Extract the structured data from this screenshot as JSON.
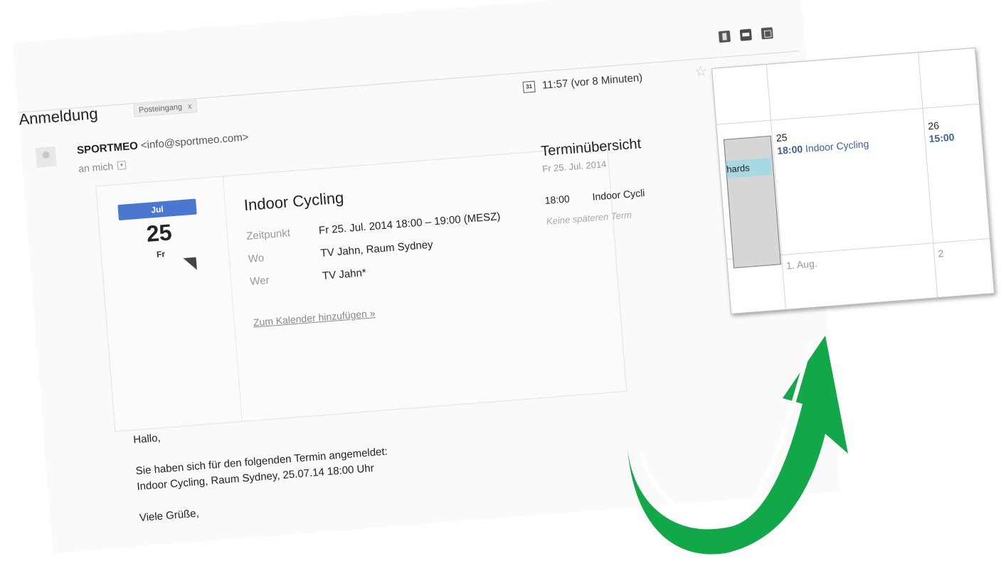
{
  "email": {
    "subject": "Anmeldung",
    "label": "Posteingang",
    "label_close": "x",
    "time": "11:57 (vor 8 Minuten)",
    "calendar_icon_text": "31",
    "sender_name": "SPORTMEO",
    "sender_email": "<info@sportmeo.com>",
    "recipient": "an mich",
    "star": "☆"
  },
  "invite": {
    "month": "Jul",
    "day": "25",
    "weekday": "Fr",
    "title": "Indoor Cycling",
    "rows": [
      {
        "label": "Zeitpunkt",
        "value": "Fr 25. Jul. 2014 18:00 – 19:00 (MESZ)"
      },
      {
        "label": "Wo",
        "value": "TV Jahn, Raum Sydney"
      },
      {
        "label": "Wer",
        "value": "TV Jahn*"
      }
    ],
    "add_link": "Zum Kalender hinzufügen »"
  },
  "agenda": {
    "title": "Terminübersicht",
    "date": "Fr 25. Jul. 2014",
    "time": "18:00",
    "event": "Indoor Cycli",
    "none": "Keine späteren Term"
  },
  "body": {
    "greeting": "Hallo,",
    "line1": "Sie haben sich für den folgenden Termin angemeldet:",
    "line2": "Indoor Cycling, Raum Sydney, 25.07.14 18:00 Uhr",
    "closing": "Viele Grüße,"
  },
  "popup": {
    "side_chip": "hards",
    "day25": "25",
    "event25_time": "18:00",
    "event25_title": "Indoor Cycling",
    "day26": "26",
    "event26_time": "15:00",
    "aug1": "1. Aug.",
    "day2": "2"
  },
  "colors": {
    "arrow": "#12a84a",
    "month_badge": "#4a78d1",
    "event_blue": "#3d5ea8",
    "chip": "#a8d8e2"
  }
}
